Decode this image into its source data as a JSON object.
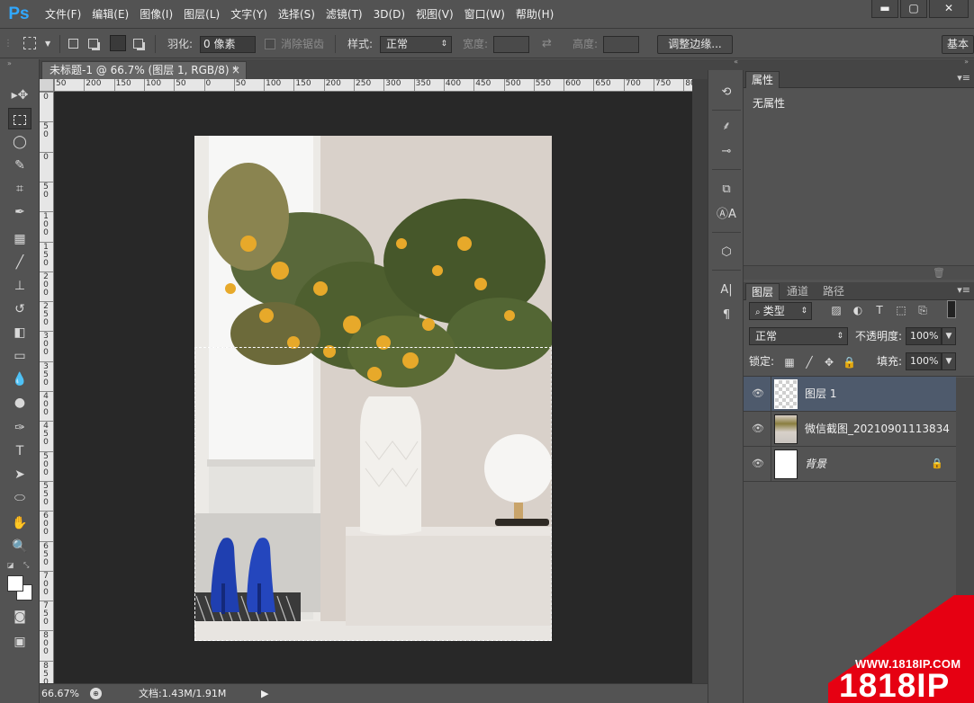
{
  "app": {
    "logo": "Ps",
    "menu": [
      "文件(F)",
      "编辑(E)",
      "图像(I)",
      "图层(L)",
      "文字(Y)",
      "选择(S)",
      "滤镜(T)",
      "3D(D)",
      "视图(V)",
      "窗口(W)",
      "帮助(H)"
    ],
    "window_controls": {
      "minimize": "▬",
      "maximize": "▢",
      "close": "✕"
    }
  },
  "options_bar": {
    "feather_label": "羽化:",
    "feather_value": "0 像素",
    "antialias_label": "消除锯齿",
    "style_label": "样式:",
    "style_value": "正常",
    "width_label": "宽度:",
    "height_label": "高度:",
    "refine_edge_button": "调整边缘...",
    "workspace_button": "基本"
  },
  "document": {
    "tab_title": "未标题-1 @ 66.7% (图层 1, RGB/8) *",
    "tab_close": "×",
    "ruler_h_labels": [
      "50",
      "200",
      "150",
      "100",
      "50",
      "0",
      "50",
      "100",
      "150",
      "200",
      "250",
      "300",
      "350",
      "400",
      "450",
      "500",
      "550",
      "600",
      "650",
      "700",
      "750",
      "80"
    ],
    "ruler_v_labels": [
      "0",
      "5 0",
      "0",
      "5 0",
      "1 0 0",
      "1 5 0",
      "2 0 0",
      "2 5 0",
      "3 0 0",
      "3 5 0",
      "4 0 0",
      "4 5 0",
      "5 0 0",
      "5 5 0",
      "6 0 0",
      "6 5 0",
      "7 0 0",
      "7 5 0",
      "8 0 0",
      "8 5 0"
    ]
  },
  "status_bar": {
    "zoom": "66.67%",
    "doc_info": "文档:1.43M/1.91M"
  },
  "properties_panel": {
    "tab": "属性",
    "content": "无属性"
  },
  "layers_panel": {
    "tabs": [
      "图层",
      "通道",
      "路径"
    ],
    "filter_kind": "类型",
    "blend_mode": "正常",
    "opacity_label": "不透明度:",
    "opacity_value": "100%",
    "lock_label": "锁定:",
    "fill_label": "填充:",
    "fill_value": "100%",
    "layers": [
      {
        "name": "图层 1",
        "selected": true
      },
      {
        "name": "微信截图_20210901113834",
        "selected": false
      },
      {
        "name": "背景",
        "selected": false,
        "locked": true
      }
    ]
  },
  "watermark": {
    "url": "WWW.1818IP.COM",
    "brand": "1818IP"
  },
  "colors": {
    "ui_bg": "#535353",
    "canvas_bg": "#282828",
    "selected_layer": "#4e5a6c",
    "ps_blue": "#31a8ff",
    "watermark_red": "#e60012"
  }
}
